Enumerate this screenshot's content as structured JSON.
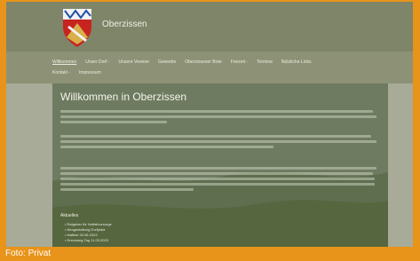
{
  "site": {
    "name": "Oberzissen"
  },
  "nav": {
    "items": [
      {
        "label": "Willkommen"
      },
      {
        "label": "Unser Dorf -"
      },
      {
        "label": "Unsere Vereine"
      },
      {
        "label": "Gewerbe"
      },
      {
        "label": "Oberzissener Bote"
      },
      {
        "label": "Freizeit -"
      },
      {
        "label": "Termine"
      },
      {
        "label": "Nützliche Links"
      },
      {
        "label": "Kontakt -"
      },
      {
        "label": "Impressum"
      }
    ]
  },
  "main": {
    "title": "Willkommen in Oberzissen",
    "news": {
      "title": "Aktuelles",
      "items": [
        "Ratgeber für Notfallvorsorge",
        "Neugestaltung Dorfplatz",
        "Malfest 30.06.2023",
        "Dreckweg-Tag 11.03.2023"
      ]
    }
  },
  "photo_credit": "Foto: Privat",
  "colors": {
    "background_orange": "#e8931a",
    "header": "#7f8568",
    "content_panel": "#6d7a5e"
  }
}
